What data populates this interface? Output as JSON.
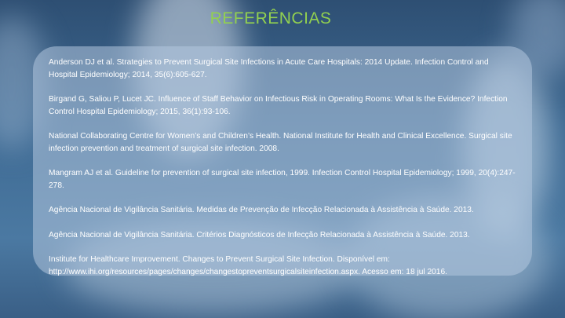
{
  "slide": {
    "title": "REFERÊNCIAS",
    "title_color": "#92d050",
    "references": [
      "Anderson DJ et al. Strategies to Prevent Surgical Site Infections in Acute Care Hospitals: 2014 Update. Infection Control and Hospital Epidemiology; 2014, 35(6):605-627.",
      "Birgand G, Saliou P, Lucet JC. Influence of Staff Behavior on Infectious Risk in Operating Rooms: What Is the Evidence? Infection Control Hospital Epidemiology; 2015, 36(1):93-106.",
      "National Collaborating Centre for Women’s and Children’s Health. National Institute for Health and Clinical Excellence. Surgical site infection prevention and treatment of surgical site infection. 2008.",
      "Mangram AJ et al. Guideline for prevention of surgical site infection, 1999. Infection Control Hospital Epidemiology; 1999, 20(4):247-278.",
      "Agência Nacional de Vigilância Sanitária. Medidas de Prevenção de Infecção Relacionada à Assistência à Saúde. 2013.",
      "Agência Nacional de Vigilância Sanitária. Critérios Diagnósticos de Infecção Relacionada à Assistência à Saúde. 2013.",
      "Institute for Healthcare Improvement. Changes to Prevent Surgical Site Infection. Disponível em: http://www.ihi.org/resources/pages/changes/changestopreventsurgicalsiteinfection.aspx. Acesso em: 18 jul 2016."
    ]
  }
}
